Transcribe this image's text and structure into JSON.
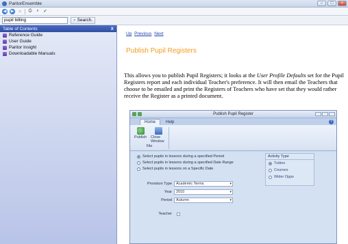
{
  "window": {
    "title": "ParitorEnsemble"
  },
  "search": {
    "value": "pupil billing",
    "button_label": "Search."
  },
  "toc": {
    "header": "Table of Contents",
    "close_glyph": "X",
    "items": [
      {
        "label": "Reference Guide"
      },
      {
        "label": "User Guide"
      },
      {
        "label": "Paritor Insight"
      },
      {
        "label": "Downloadable Manuals"
      }
    ]
  },
  "content": {
    "nav": {
      "up": "Up",
      "previous": "Previous",
      "next": "Next"
    },
    "title": "Publish Pupil Registers",
    "paragraph_pre": "This allows you to publish Pupil Registers; it looks at the ",
    "paragraph_em": "User Profile Defaults",
    "paragraph_post": " set for the Pupil Registers report and each individual Teacher's preference. It will then email the Teachers that choose to be emailed and print the Registers of Teachers who have set that they would rather receive the Register as a printed document."
  },
  "dialog": {
    "title": "Publish Pupil Register",
    "tabs": [
      "Home",
      "Help"
    ],
    "buttons": {
      "publish": "Publish",
      "close": "Close Window"
    },
    "group_label": "File",
    "period_options": [
      {
        "label": "Select pupils in lessons during a specified Period",
        "selected": true
      },
      {
        "label": "Select pupils in lessons during a specified Date Range",
        "selected": false
      },
      {
        "label": "Select pupils in lessons on a Specific Date",
        "selected": false
      }
    ],
    "activity_type": {
      "title": "Activity Type",
      "options": [
        {
          "label": "Tuition",
          "selected": true
        },
        {
          "label": "Courses",
          "selected": false
        },
        {
          "label": "Wider Opps",
          "selected": false
        }
      ]
    },
    "fields": {
      "provision_type": {
        "label": "Provision Type",
        "value": "Academic Terms"
      },
      "year": {
        "label": "Year",
        "value": "2010"
      },
      "period": {
        "label": "Period",
        "value": "Autumn"
      },
      "teacher": {
        "label": "Teacher"
      }
    }
  },
  "colors": {
    "title_accent": "#f39a1c",
    "link": "#1a3fb0",
    "toc_header": "#3a58b0"
  }
}
